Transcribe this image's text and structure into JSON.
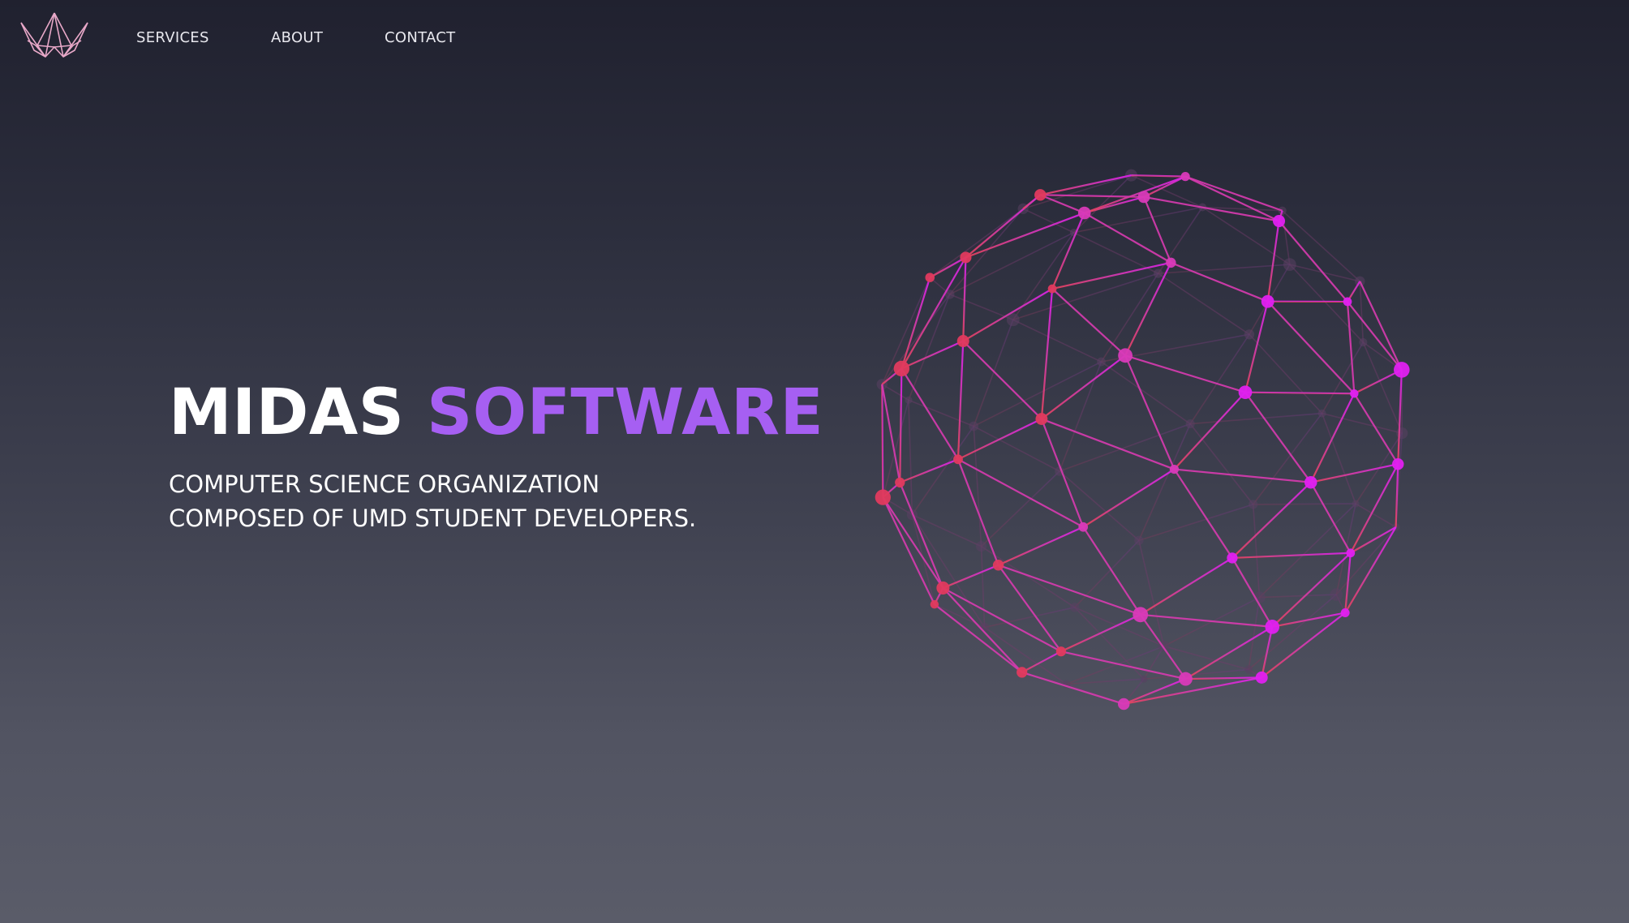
{
  "nav": {
    "logo_icon": "crown-icon",
    "links": [
      "SERVICES",
      "ABOUT",
      "CONTACT"
    ]
  },
  "hero": {
    "title_part1": "MIDAS",
    "title_part2": "SOFTWARE",
    "subtitle_line1": "COMPUTER SCIENCE ORGANIZATION",
    "subtitle_line2": "COMPOSED OF UMD STUDENT DEVELOPERS."
  },
  "graphic": {
    "icon": "wireframe-globe-icon"
  },
  "colors": {
    "accent_purple": "#a65ff2",
    "globe_magenta": "#e020f0",
    "globe_red": "#e03a5e",
    "background_top": "#20212f",
    "background_bottom": "#5a5c69"
  }
}
